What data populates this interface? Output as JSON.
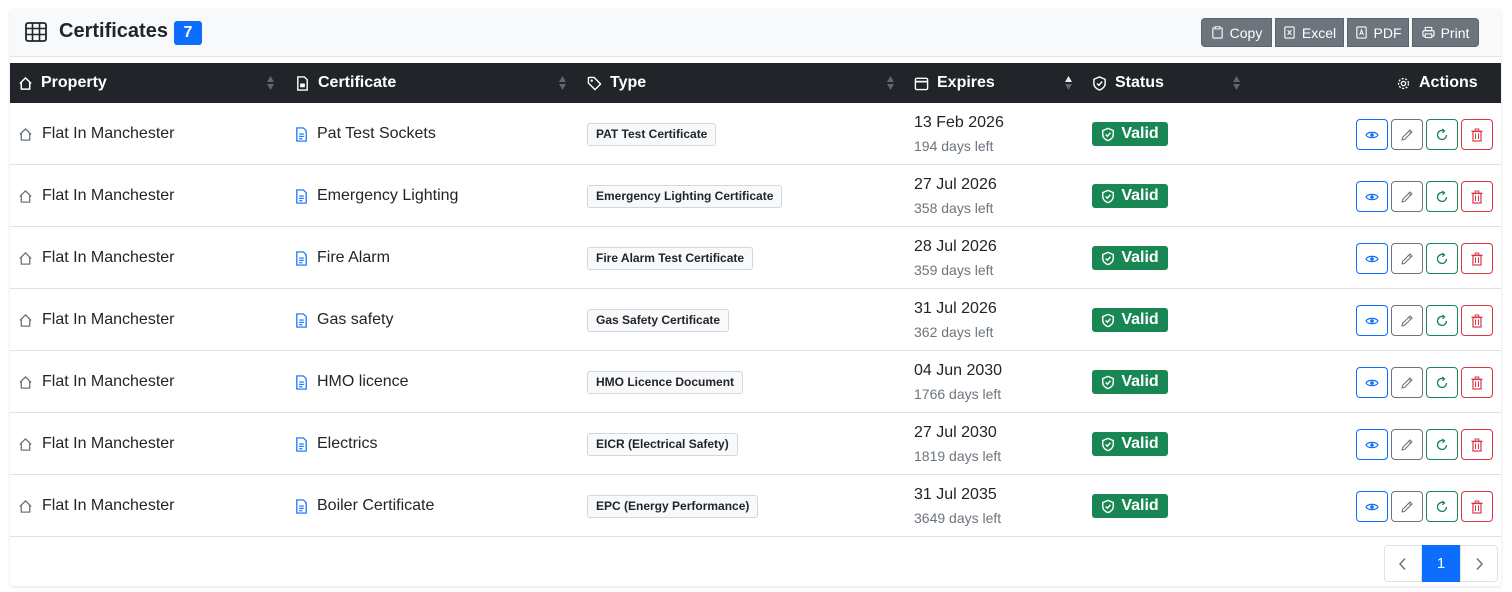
{
  "header": {
    "title": "Certificates",
    "count": "7",
    "export_buttons": [
      {
        "label": "Copy",
        "icon": "clipboard-icon"
      },
      {
        "label": "Excel",
        "icon": "file-excel-icon"
      },
      {
        "label": "PDF",
        "icon": "file-pdf-icon"
      },
      {
        "label": "Print",
        "icon": "printer-icon"
      }
    ]
  },
  "table": {
    "columns": [
      {
        "label": "Property",
        "icon": "house-icon"
      },
      {
        "label": "Certificate",
        "icon": "file-icon"
      },
      {
        "label": "Type",
        "icon": "tags-icon"
      },
      {
        "label": "Expires",
        "icon": "calendar-icon"
      },
      {
        "label": "Status",
        "icon": "shield-check-icon"
      },
      {
        "label": "Actions",
        "icon": "gear-icon"
      }
    ],
    "rows": [
      {
        "property": "Flat In Manchester",
        "certificate": "Pat Test Sockets",
        "type": "PAT Test Certificate",
        "expires": "13 Feb 2026",
        "days_left": "194 days left",
        "status": "Valid"
      },
      {
        "property": "Flat In Manchester",
        "certificate": "Emergency Lighting",
        "type": "Emergency Lighting Certificate",
        "expires": "27 Jul 2026",
        "days_left": "358 days left",
        "status": "Valid"
      },
      {
        "property": "Flat In Manchester",
        "certificate": "Fire Alarm",
        "type": "Fire Alarm Test Certificate",
        "expires": "28 Jul 2026",
        "days_left": "359 days left",
        "status": "Valid"
      },
      {
        "property": "Flat In Manchester",
        "certificate": "Gas safety",
        "type": "Gas Safety Certificate",
        "expires": "31 Jul 2026",
        "days_left": "362 days left",
        "status": "Valid"
      },
      {
        "property": "Flat In Manchester",
        "certificate": "HMO licence",
        "type": "HMO Licence Document",
        "expires": "04 Jun 2030",
        "days_left": "1766 days left",
        "status": "Valid"
      },
      {
        "property": "Flat In Manchester",
        "certificate": "Electrics",
        "type": "EICR (Electrical Safety)",
        "expires": "27 Jul 2030",
        "days_left": "1819 days left",
        "status": "Valid"
      },
      {
        "property": "Flat In Manchester",
        "certificate": "Boiler Certificate",
        "type": "EPC (Energy Performance)",
        "expires": "31 Jul 2035",
        "days_left": "3649 days left",
        "status": "Valid"
      }
    ],
    "row_actions": [
      "eye-icon",
      "pencil-icon",
      "refresh-icon",
      "trash-icon"
    ]
  },
  "pagination": {
    "current_page": "1"
  },
  "colors": {
    "header_dark": "#212529",
    "primary": "#0d6efd",
    "success": "#198754",
    "danger": "#dc3545",
    "secondary": "#6c757d"
  }
}
